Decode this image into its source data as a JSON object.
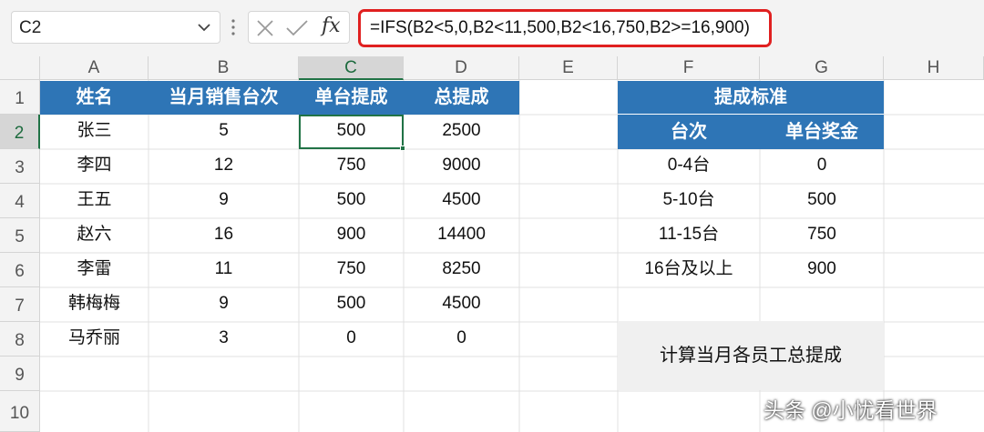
{
  "formula_bar": {
    "name_box": "C2",
    "fx_label": "fx",
    "formula": "=IFS(B2<5,0,B2<11,500,B2<16,750,B2>=16,900)"
  },
  "columns": [
    "A",
    "B",
    "C",
    "D",
    "E",
    "F",
    "G",
    "H"
  ],
  "rows": [
    "1",
    "2",
    "3",
    "4",
    "5",
    "6",
    "7",
    "8",
    "9",
    "10"
  ],
  "selected_cell": "C2",
  "table": {
    "headers": [
      "姓名",
      "当月销售台次",
      "单台提成",
      "总提成"
    ],
    "rows": [
      [
        "张三",
        "5",
        "500",
        "2500"
      ],
      [
        "李四",
        "12",
        "750",
        "9000"
      ],
      [
        "王五",
        "9",
        "500",
        "4500"
      ],
      [
        "赵六",
        "16",
        "900",
        "14400"
      ],
      [
        "李雷",
        "11",
        "750",
        "8250"
      ],
      [
        "韩梅梅",
        "9",
        "500",
        "4500"
      ],
      [
        "马乔丽",
        "3",
        "0",
        "0"
      ]
    ]
  },
  "standard": {
    "title": "提成标准",
    "headers": [
      "台次",
      "单台奖金"
    ],
    "rows": [
      [
        "0-4台",
        "0"
      ],
      [
        "5-10台",
        "500"
      ],
      [
        "11-15台",
        "750"
      ],
      [
        "16台及以上",
        "900"
      ]
    ]
  },
  "note": "计算当月各员工总提成",
  "watermark": "头条 @小忧看世界",
  "colors": {
    "header_blue": "#2e75b6",
    "selection_green": "#217346",
    "formula_highlight": "#e02020"
  }
}
